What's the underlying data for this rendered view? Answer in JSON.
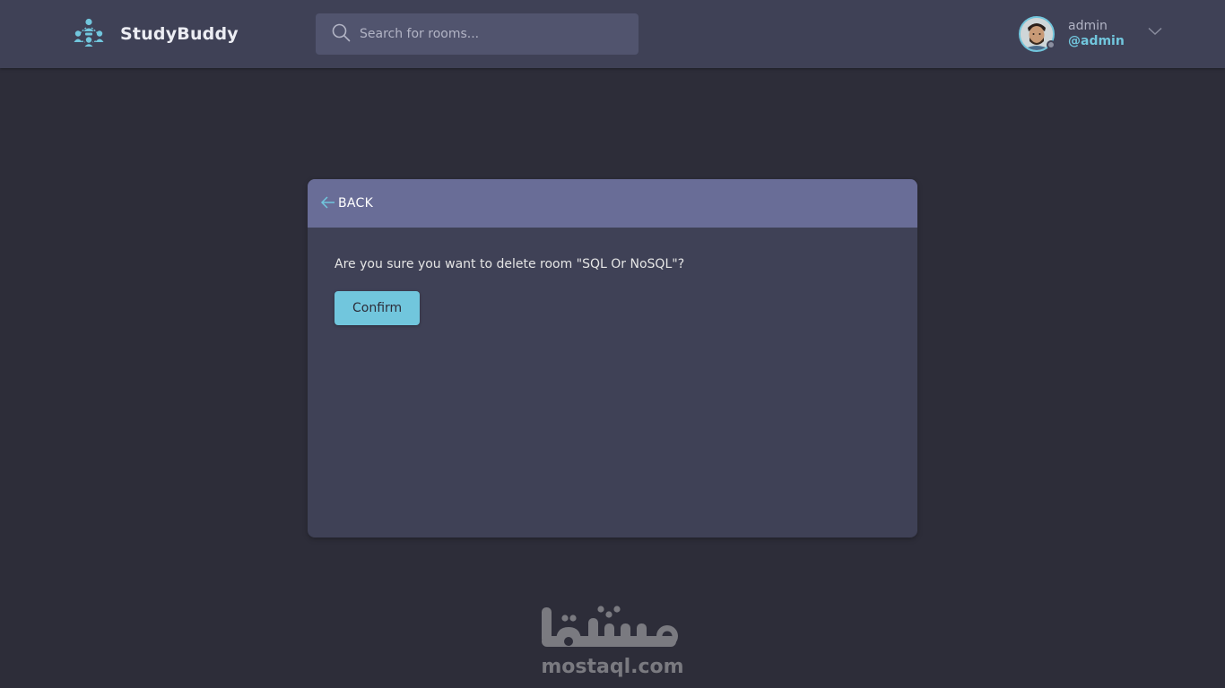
{
  "header": {
    "brand": {
      "title": "StudyBuddy",
      "icon": "studybuddy-logo-icon",
      "color": "#71c6dd"
    },
    "search": {
      "placeholder": "Search for rooms...",
      "value": "",
      "icon": "search-icon"
    },
    "user": {
      "name": "admin",
      "handle": "@admin",
      "status": "offline",
      "icon": "chevron-down-icon"
    }
  },
  "card": {
    "back_label": "BACK",
    "back_icon": "arrow-left-icon",
    "message": "Are you sure you want to delete room \"SQL Or NoSQL\"?",
    "confirm_label": "Confirm"
  },
  "watermark": {
    "arabic": "مستقل",
    "latin": "mostaql.com"
  },
  "colors": {
    "background": "#2d2d39",
    "header": "#3f4156",
    "card_header": "#696d97",
    "accent": "#71c6dd"
  }
}
